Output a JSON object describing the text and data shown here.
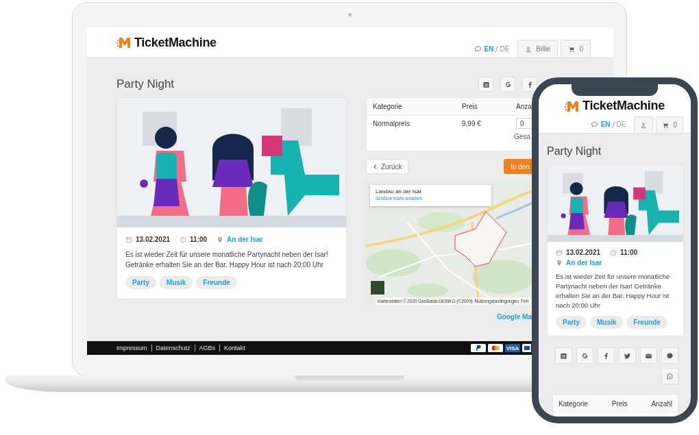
{
  "laptop": {
    "header": {
      "logo": "TicketMachine",
      "languages": [
        {
          "label": "EN",
          "selected": true
        },
        {
          "label": "DE",
          "selected": false
        }
      ],
      "user": "Billie",
      "cart_count": "0"
    },
    "title": "Party Night",
    "share_buttons": [
      {
        "kind": "calendar"
      },
      {
        "kind": "google"
      },
      {
        "kind": "facebook"
      }
    ],
    "event": {
      "date": "13.02.2021",
      "time": "11:00",
      "location": "An der Isar",
      "description": "Es ist wieder Zeit für unsere monatliche Partynacht neben der Isar! Getränke erhalten Sie an der Bar. Happy Hour ist nach 20:00 Uhr",
      "tags": [
        "Party",
        "Musik",
        "Freunde"
      ]
    },
    "tickets": {
      "columns": [
        "Kategorie",
        "Preis",
        "Anza"
      ],
      "rows": [
        {
          "category": "Normalpreis",
          "price": "9,99 €",
          "quantity": "0"
        }
      ],
      "total_label": "Gesa"
    },
    "back_button": "Zurück",
    "cart_button": "In den",
    "map": {
      "place": "Landau an der Isar",
      "link": "Größere Karte ansehen",
      "attribution": "Kartendaten © 2020 GeoBasis-DE/BKG (©2009)",
      "terms": "Nutzungsbedingungen",
      "report": "Feh"
    },
    "map_link": "Google Ma",
    "footer_links": [
      "Impressum",
      "Datenschutz",
      "AGBs",
      "Kontakt"
    ],
    "payment_methods": [
      {
        "kind": "paypal"
      },
      {
        "kind": "mastercard"
      },
      {
        "kind": "visa",
        "label": "VISA"
      },
      {
        "kind": "sepa"
      }
    ]
  },
  "phone": {
    "header": {
      "logo": "TicketMachine",
      "languages": [
        {
          "label": "EN",
          "selected": true
        },
        {
          "label": "DE",
          "selected": false
        }
      ],
      "cart_count": "0"
    },
    "title": "Party Night",
    "event": {
      "date": "13.02.2021",
      "time": "11:00",
      "location": "An der Isar",
      "description": "Es ist wieder Zeit für unsere monatliche Partynacht neben der Isar! Getränke erhalten Sie an der Bar. Happy Hour ist nach 20:00 Uhr",
      "tags": [
        "Party",
        "Musik",
        "Freunde"
      ]
    },
    "share_buttons": [
      {
        "kind": "calendar"
      },
      {
        "kind": "google"
      },
      {
        "kind": "facebook"
      },
      {
        "kind": "twitter"
      },
      {
        "kind": "email"
      },
      {
        "kind": "messenger"
      },
      {
        "kind": "whatsapp"
      }
    ],
    "tickets": {
      "columns": [
        "Kategorie",
        "Preis",
        "Anzahl"
      ]
    }
  }
}
